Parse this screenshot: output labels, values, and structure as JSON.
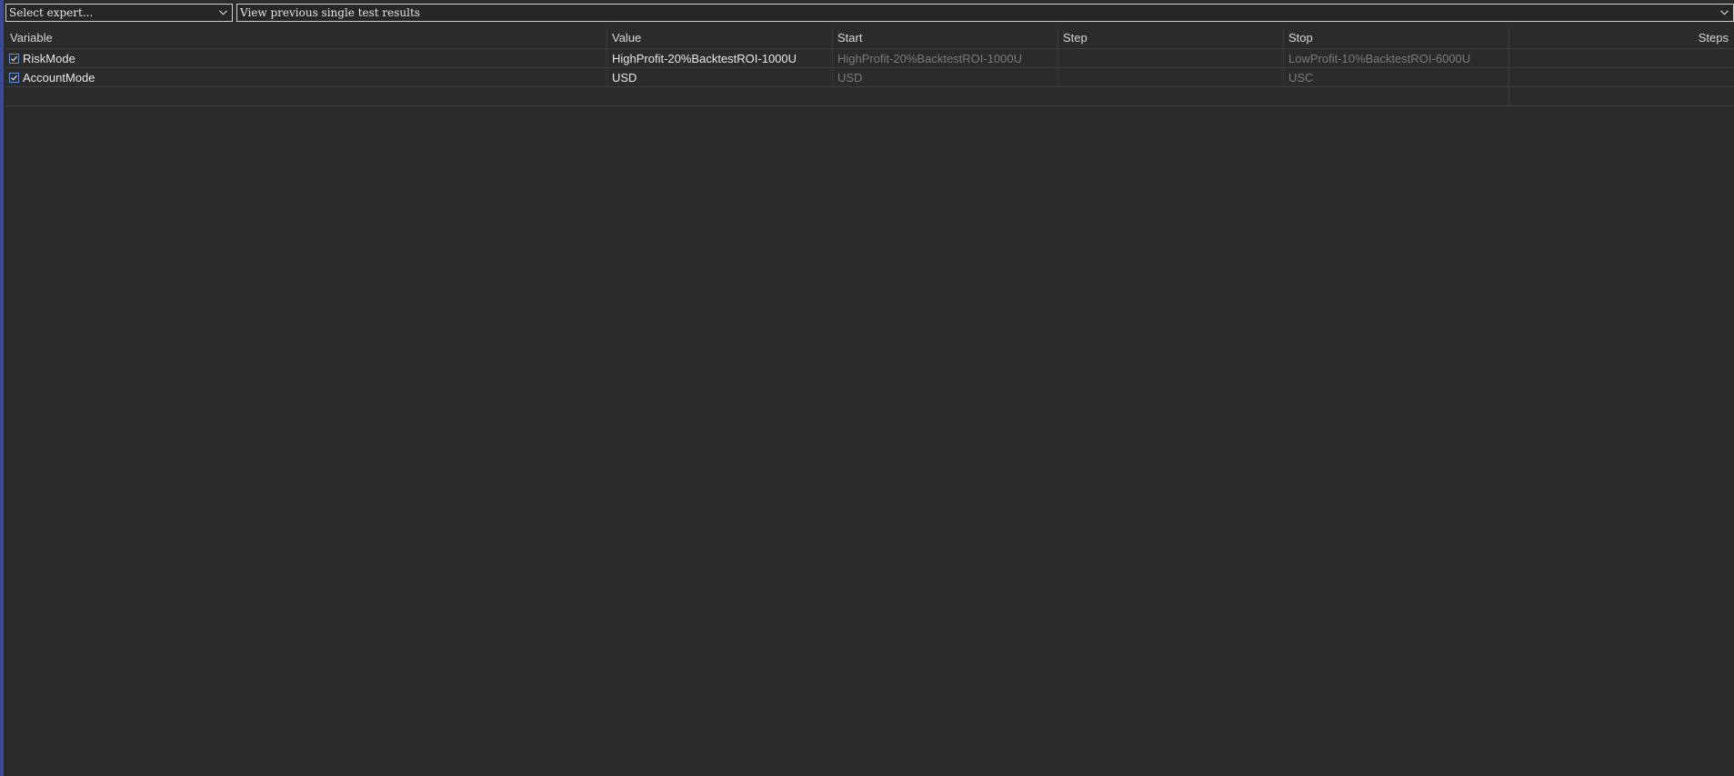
{
  "toolbar": {
    "expert_select": {
      "value": "Select expert...",
      "icon": "chevron-down-icon"
    },
    "history_select": {
      "value": "View previous single test results",
      "icon": "chevron-down-icon"
    }
  },
  "table": {
    "columns": {
      "variable": "Variable",
      "value": "Value",
      "start": "Start",
      "step": "Step",
      "stop": "Stop",
      "steps": "Steps"
    },
    "rows": [
      {
        "checked": true,
        "variable": "RiskMode",
        "value": "HighProfit-20%BacktestROI-1000U",
        "start": "HighProfit-20%BacktestROI-1000U",
        "step": "",
        "stop": "LowProfit-10%BacktestROI-6000U",
        "steps": ""
      },
      {
        "checked": true,
        "variable": "AccountMode",
        "value": "USD",
        "start": "USD",
        "step": "",
        "stop": "USC",
        "steps": ""
      }
    ]
  },
  "colors": {
    "background": "#2b2b2b",
    "accent_bar": "#3a4a9a",
    "checkbox_border": "#5d8fd8",
    "text": "#d4d4d4",
    "dim_text": "#7a7a7a"
  }
}
